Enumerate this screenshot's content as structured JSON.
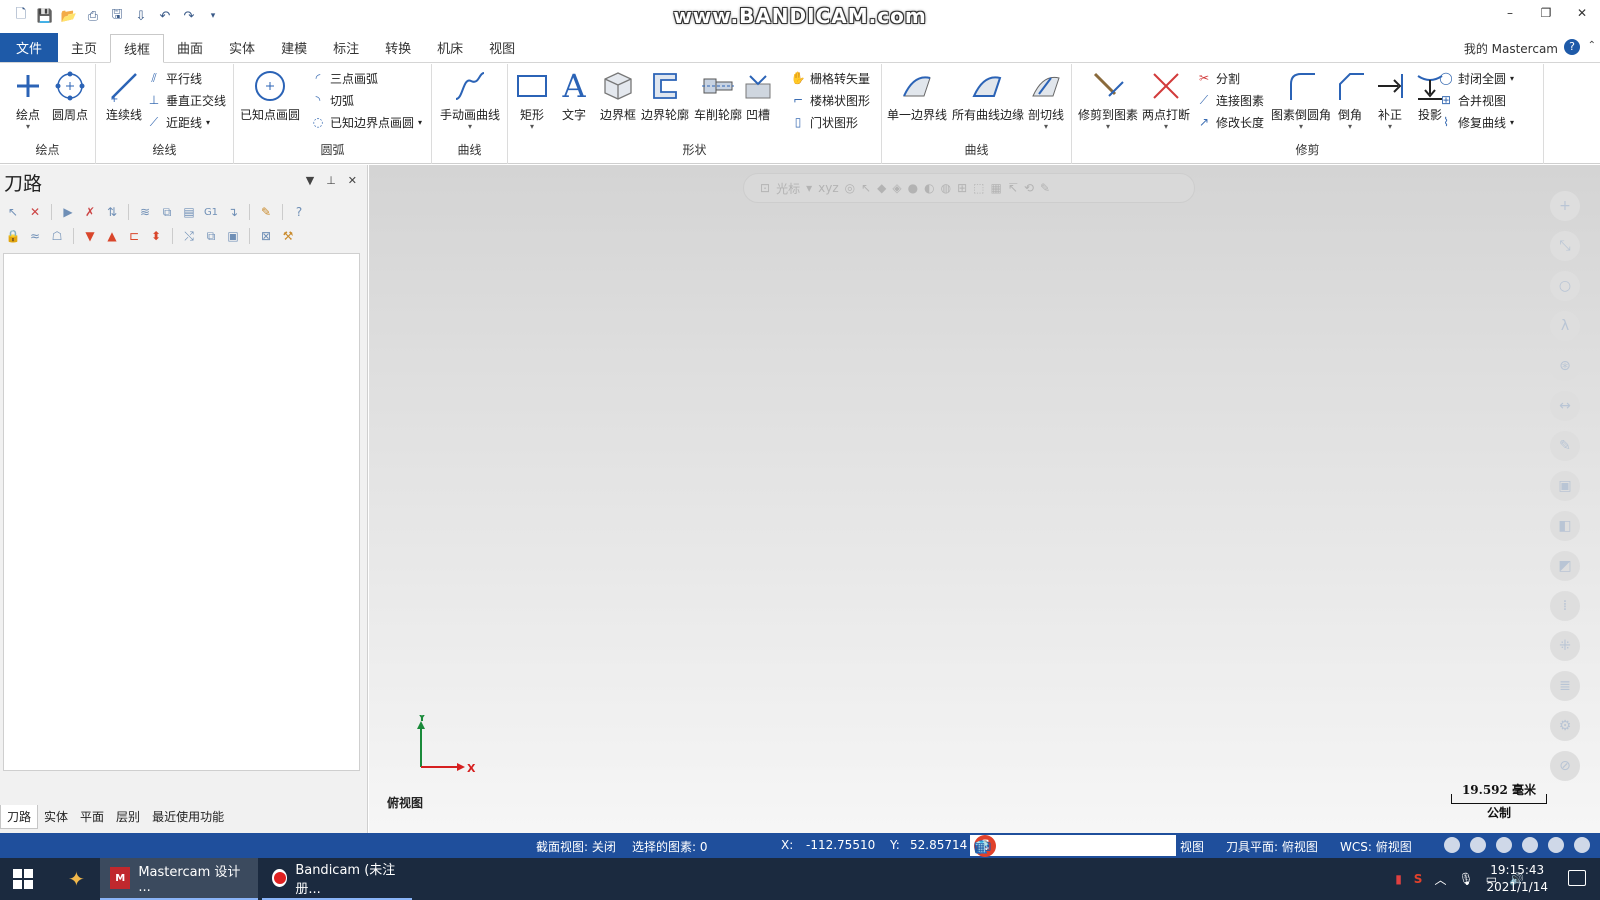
{
  "watermark": "www.BANDICAM.com",
  "menu": {
    "file": "文件",
    "tabs": [
      "主页",
      "线框",
      "曲面",
      "实体",
      "建模",
      "标注",
      "转换",
      "机床",
      "视图"
    ],
    "active_tab": "线框",
    "account": "我的 Mastercam"
  },
  "ribbon": {
    "points": {
      "label": "绘点",
      "draw_point": "绘点",
      "bolt_circle": "圆周点"
    },
    "lines": {
      "label": "绘线",
      "line_endpoints": "连续线",
      "parallel": "平行线",
      "perpendicular": "垂直正交线",
      "closest": "近距线"
    },
    "arcs": {
      "label": "圆弧",
      "circle_center": "已知点画圆",
      "arc_3pt": "三点画弧",
      "tangent": "切弧",
      "arc_edge": "已知边界点画圆"
    },
    "spline": {
      "label": "曲线",
      "manual": "手动画曲线"
    },
    "shapes": {
      "label": "形状",
      "rectangle": "矩形",
      "text": "文字",
      "bounding_box": "边界框",
      "boundary": "边界轮廓",
      "turn_profile": "车削轮廓",
      "groove": "凹槽",
      "raster_vector": "栅格转矢量",
      "stair": "楼梯状图形",
      "door": "门状图形"
    },
    "curves": {
      "label": "曲线",
      "single_edge": "单一边界线",
      "all_edges": "所有曲线边缘",
      "slice": "剖切线"
    },
    "modify": {
      "label": "修剪",
      "trim": "修剪到图素",
      "break_two": "两点打断",
      "divide": "分割",
      "join": "连接图素",
      "modify_length": "修改长度",
      "fillet": "图素倒圆角",
      "chamfer": "倒角",
      "offset": "补正",
      "project": "投影",
      "close_arc": "封闭全圆",
      "join_view": "合并视图",
      "repair": "修复曲线"
    }
  },
  "panel": {
    "title": "刀路",
    "tabs": [
      "刀路",
      "实体",
      "平面",
      "层别",
      "最近使用功能"
    ],
    "active_tab": "刀路"
  },
  "viewport": {
    "float_label": "光标",
    "view_name": "俯视图",
    "axis_x": "X",
    "axis_y": "Y",
    "scale_value": "19.592 毫米",
    "scale_unit": "公制"
  },
  "status": {
    "section_view": "截面视图: 关闭",
    "selected": "选择的图素: 0",
    "x_label": "X:",
    "x_value": "-112.75510",
    "y_label": "Y:",
    "y_value": "52.85714",
    "ime_text": "中",
    "view": "视图",
    "tool_plane": "刀具平面: 俯视图",
    "wcs": "WCS: 俯视图"
  },
  "taskbar": {
    "app1": "Mastercam 设计 ...",
    "app2": "Bandicam (未注册...",
    "time": "19:15:43",
    "date": "2021/1/14"
  },
  "colors": {
    "accent": "#1e5aa8",
    "statusbar": "#1f4f9c",
    "taskbar": "#1b2a3f",
    "axis_x": "#d62020",
    "axis_y": "#1a8a3a"
  }
}
